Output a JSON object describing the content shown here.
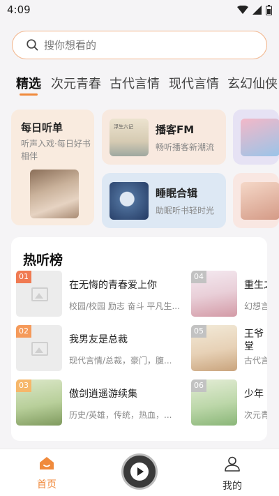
{
  "status": {
    "time": "4:09"
  },
  "search": {
    "placeholder": "搜你想看的"
  },
  "tabs": [
    "精选",
    "次元青春",
    "古代言情",
    "现代言情",
    "玄幻仙侠"
  ],
  "tiles": {
    "daily": {
      "title": "每日听单",
      "desc": "听声入戏·每日好书相伴"
    },
    "podcast": {
      "title": "播客FM",
      "sub": "畅听播客新潮流",
      "cover_text": "浮生六记"
    },
    "sleep": {
      "title": "睡眠合辑",
      "sub": "助眠听书轻时光"
    }
  },
  "hot": {
    "title": "热听榜",
    "items": [
      {
        "rank": "01",
        "title": "在无悔的青春爱上你",
        "tags": "校园/校园 励志 奋斗 平凡生..."
      },
      {
        "rank": "02",
        "title": "我男友是总裁",
        "tags": "现代言情/总裁，豪门，腹..."
      },
      {
        "rank": "03",
        "title": "傲剑逍遥游续集",
        "tags": "历史/英雄，传统，热血，..."
      },
      {
        "rank": "04",
        "title": "重生之",
        "tags": "幻想言"
      },
      {
        "rank": "05",
        "title": "王爷",
        "title2": "堂",
        "tags": "古代言"
      },
      {
        "rank": "06",
        "title": "少年",
        "tags": "次元青"
      }
    ]
  },
  "nav": {
    "home": "首页",
    "me": "我的"
  },
  "colors": {
    "accent": "#f08a3c",
    "search_border": "#f2b48a"
  }
}
